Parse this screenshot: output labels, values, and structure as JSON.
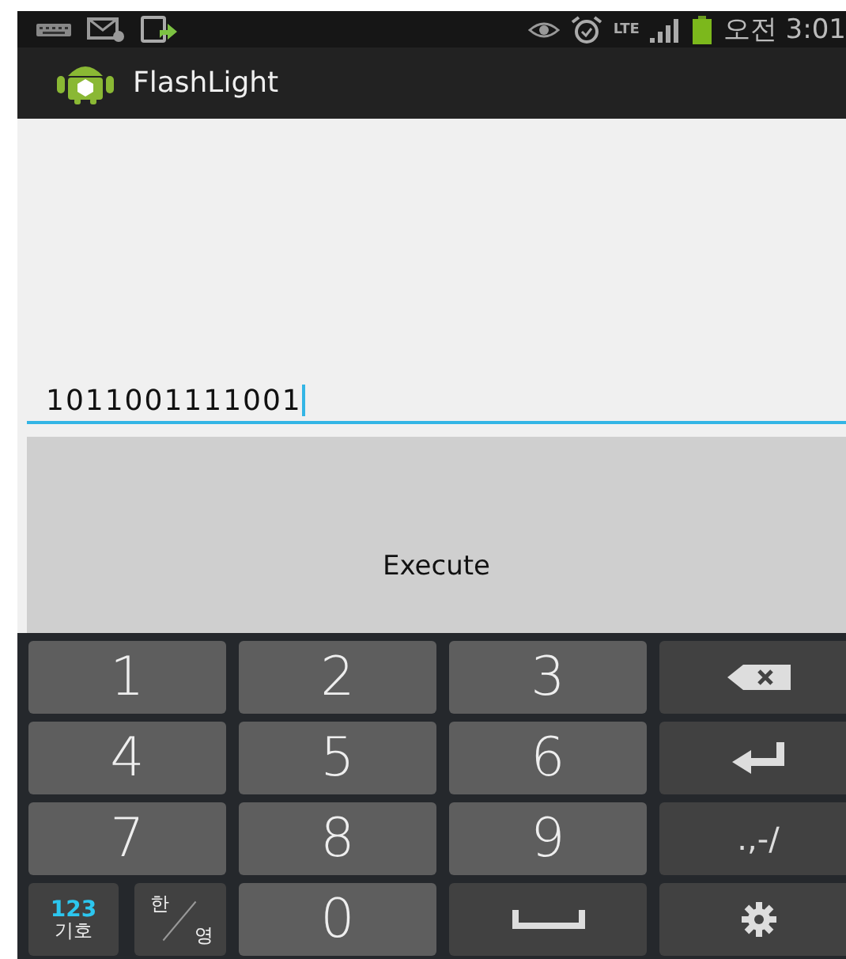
{
  "status_bar": {
    "network_label": "LTE",
    "time": "오전 3:01"
  },
  "action_bar": {
    "title": "FlashLight"
  },
  "input": {
    "value": "1011001111001",
    "focused": true
  },
  "execute_button": {
    "label": "Execute"
  },
  "keyboard": {
    "rows": [
      [
        {
          "kind": "digit",
          "label": "1"
        },
        {
          "kind": "digit",
          "label": "2"
        },
        {
          "kind": "digit",
          "label": "3"
        },
        {
          "kind": "backspace"
        }
      ],
      [
        {
          "kind": "digit",
          "label": "4"
        },
        {
          "kind": "digit",
          "label": "5"
        },
        {
          "kind": "digit",
          "label": "6"
        },
        {
          "kind": "enter"
        }
      ],
      [
        {
          "kind": "digit",
          "label": "7"
        },
        {
          "kind": "digit",
          "label": "8"
        },
        {
          "kind": "digit",
          "label": "9"
        },
        {
          "kind": "symbols",
          "label": ".,-/"
        }
      ],
      [
        {
          "kind": "pair",
          "keys": [
            {
              "kind": "mode",
              "label": "123",
              "sublabel": "기호"
            },
            {
              "kind": "lang",
              "top": "한",
              "bottom": "영"
            }
          ]
        },
        {
          "kind": "digit",
          "label": "0"
        },
        {
          "kind": "space"
        },
        {
          "kind": "settings"
        }
      ]
    ]
  }
}
